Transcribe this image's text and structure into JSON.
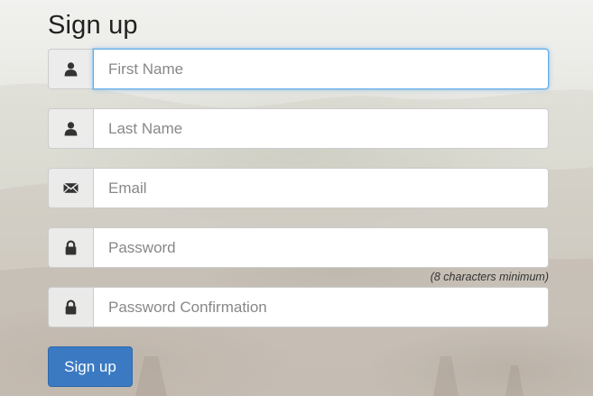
{
  "form": {
    "title": "Sign up",
    "fields": [
      {
        "placeholder": "First Name",
        "icon": "user-icon",
        "focused": true
      },
      {
        "placeholder": "Last Name",
        "icon": "user-icon"
      },
      {
        "placeholder": "Email",
        "icon": "envelope-icon"
      },
      {
        "placeholder": "Password",
        "icon": "lock-icon",
        "help": "(8 characters minimum)"
      },
      {
        "placeholder": "Password Confirmation",
        "icon": "lock-icon"
      }
    ],
    "submit_label": "Sign up"
  },
  "colors": {
    "accent": "#3b7ac2",
    "focus_border": "#66afe9",
    "addon_background": "#ececec"
  }
}
